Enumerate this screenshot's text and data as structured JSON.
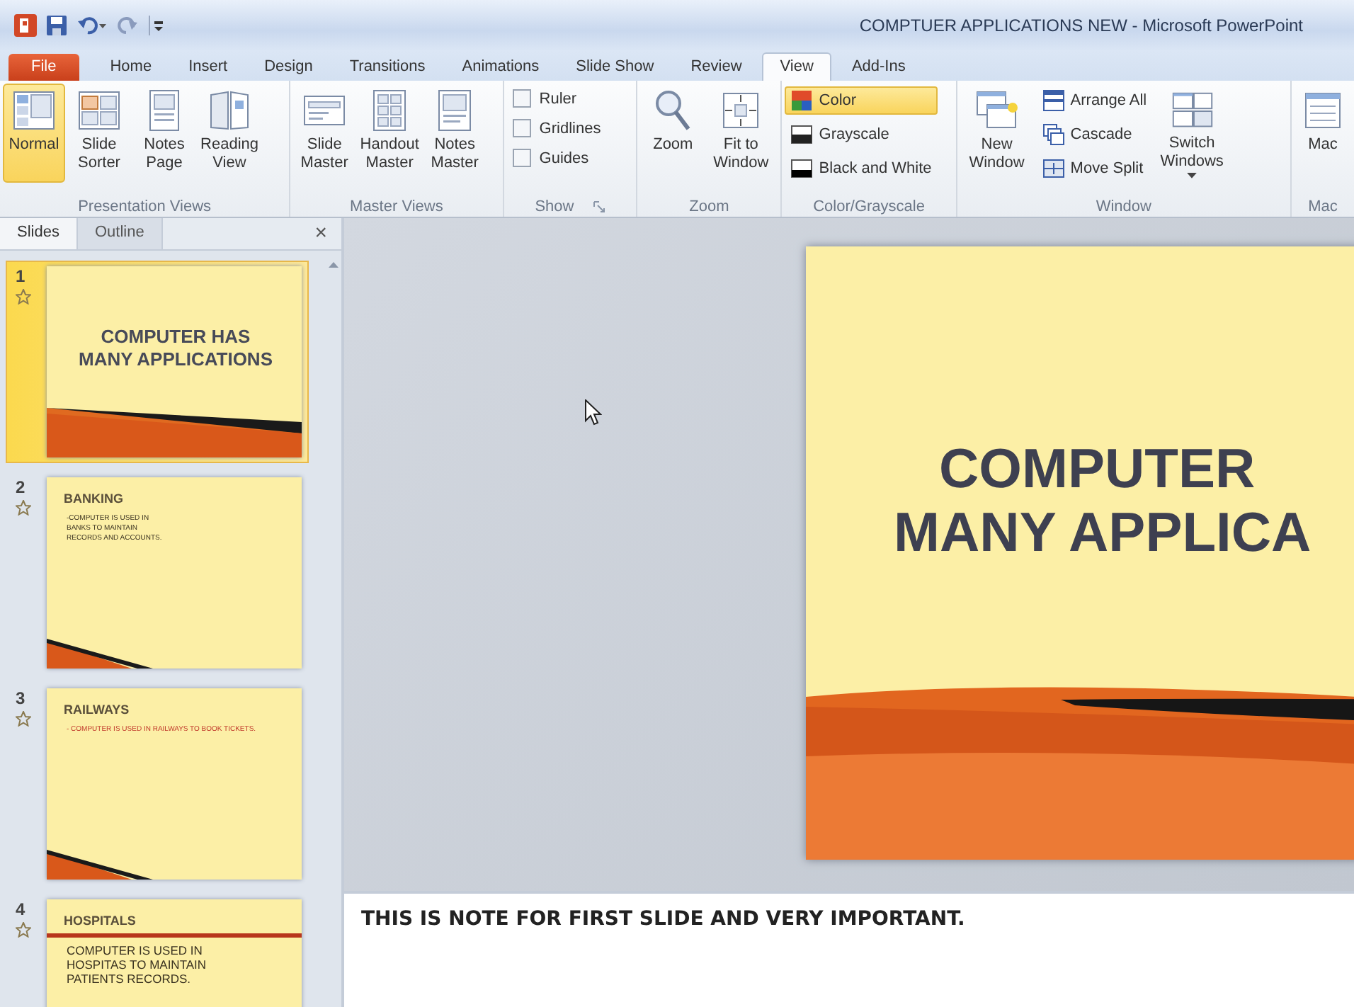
{
  "window": {
    "title": "COMPTUER APPLICATIONS NEW - Microsoft PowerPoint"
  },
  "tabs": [
    {
      "label": "File",
      "selected": false,
      "kind": "file"
    },
    {
      "label": "Home",
      "selected": false
    },
    {
      "label": "Insert",
      "selected": false
    },
    {
      "label": "Design",
      "selected": false
    },
    {
      "label": "Transitions",
      "selected": false
    },
    {
      "label": "Animations",
      "selected": false
    },
    {
      "label": "Slide Show",
      "selected": false
    },
    {
      "label": "Review",
      "selected": false
    },
    {
      "label": "View",
      "selected": true
    },
    {
      "label": "Add-Ins",
      "selected": false
    }
  ],
  "ribbon": {
    "groups": [
      {
        "label": "Presentation Views",
        "launcher": false,
        "items": [
          {
            "kind": "large",
            "label": "Normal",
            "selected": true
          },
          {
            "kind": "large",
            "label": "Slide Sorter",
            "selected": false
          },
          {
            "kind": "large",
            "label": "Notes Page",
            "selected": false
          },
          {
            "kind": "large",
            "label": "Reading View",
            "selected": false
          }
        ]
      },
      {
        "label": "Master Views",
        "launcher": false,
        "items": [
          {
            "kind": "large",
            "label": "Slide Master",
            "selected": false
          },
          {
            "kind": "large",
            "label": "Handout Master",
            "selected": false
          },
          {
            "kind": "large",
            "label": "Notes Master",
            "selected": false
          }
        ]
      },
      {
        "label": "Show",
        "launcher": true,
        "items": [
          {
            "kind": "check",
            "label": "Ruler",
            "checked": false
          },
          {
            "kind": "check",
            "label": "Gridlines",
            "checked": false
          },
          {
            "kind": "check",
            "label": "Guides",
            "checked": false
          }
        ]
      },
      {
        "label": "Zoom",
        "launcher": false,
        "items": [
          {
            "kind": "large",
            "label": "Zoom",
            "selected": false
          },
          {
            "kind": "large",
            "label": "Fit to Window",
            "selected": false
          }
        ]
      },
      {
        "label": "Color/Grayscale",
        "launcher": false,
        "items": [
          {
            "kind": "small",
            "label": "Color",
            "selected": true
          },
          {
            "kind": "small",
            "label": "Grayscale",
            "selected": false
          },
          {
            "kind": "small",
            "label": "Black and White",
            "selected": false
          }
        ]
      },
      {
        "label": "Window",
        "launcher": false,
        "items": [
          {
            "kind": "large",
            "label": "New Window",
            "selected": false
          },
          {
            "kind": "small",
            "label": "Arrange All",
            "selected": false
          },
          {
            "kind": "small",
            "label": "Cascade",
            "selected": false
          },
          {
            "kind": "small",
            "label": "Move Split",
            "selected": false
          },
          {
            "kind": "large",
            "label": "Switch Windows",
            "selected": false,
            "dropdown": true
          }
        ]
      },
      {
        "label": "Mac",
        "launcher": false,
        "items": [
          {
            "kind": "large",
            "label": "Mac",
            "selected": false
          }
        ]
      }
    ]
  },
  "slides_pane": {
    "tabs": [
      {
        "label": "Slides",
        "selected": true
      },
      {
        "label": "Outline",
        "selected": false
      }
    ],
    "close": "×",
    "slides": [
      {
        "number": "1",
        "selected": true,
        "kind": "title",
        "title": "COMPUTER HAS MANY APPLICATIONS"
      },
      {
        "number": "2",
        "selected": false,
        "kind": "content",
        "title": "BANKING",
        "body": "-COMPUTER IS USED IN BANKS TO MAINTAIN RECORDS AND ACCOUNTS.",
        "color": "#3a3220"
      },
      {
        "number": "3",
        "selected": false,
        "kind": "content",
        "title": "RAILWAYS",
        "body": "- COMPUTER IS USED IN RAILWAYS TO BOOK TICKETS.",
        "color": "#c0392b"
      },
      {
        "number": "4",
        "selected": false,
        "kind": "ruled",
        "title": "HOSPITALS",
        "body": "COMPUTER IS USED IN HOSPITAS TO MAINTAIN PATIENTS RECORDS.",
        "color": "#3a3220"
      }
    ]
  },
  "editor": {
    "slide": {
      "title_lines": [
        "COMPUTER",
        "MANY APPLICA"
      ]
    },
    "notes": "THIS IS NOTE FOR FIRST SLIDE AND VERY IMPORTANT."
  }
}
